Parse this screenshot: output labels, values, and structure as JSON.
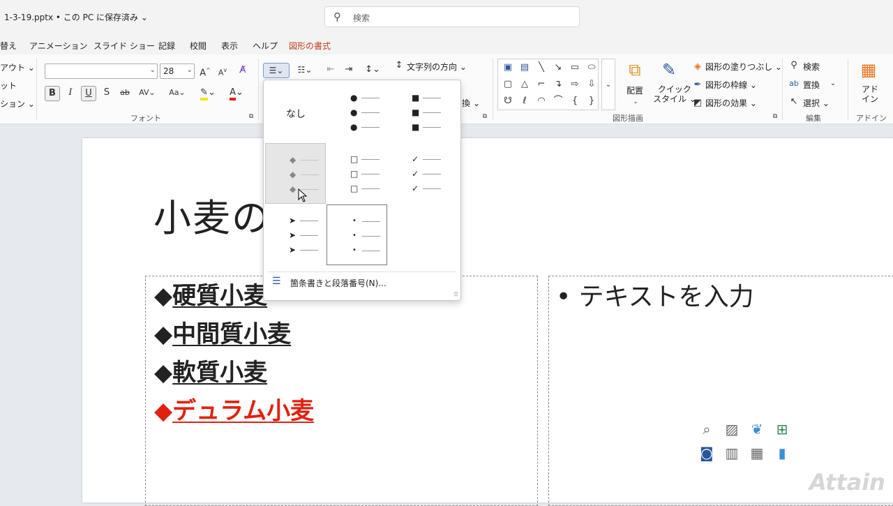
{
  "titlebar": {
    "filename": "1-3-19.pptx • この PC に保存済み ⌄",
    "search_placeholder": "検索"
  },
  "tabs": [
    "替え",
    "アニメーション",
    "スライド ショー",
    "記録",
    "校閲",
    "表示",
    "ヘルプ",
    "図形の書式"
  ],
  "ribbon": {
    "left_items": [
      "アウト ⌄",
      "ット",
      "ション ⌄"
    ],
    "font_name": "",
    "font_size": "28",
    "font_group_label": "フォント",
    "text_direction": "文字列の方向 ⌄",
    "convert_partial": "換 ⌄",
    "drawing_group_label": "図形描画",
    "arrange_label": "配置",
    "quick_style_label": "クイック\nスタイル ⌄",
    "shape_fill": "図形の塗りつぶし ⌄",
    "shape_outline": "図形の枠線 ⌄",
    "shape_effects": "図形の効果 ⌄",
    "find": "検索",
    "replace": "置換",
    "select": "選択 ⌄",
    "editing_group_label": "編集",
    "addins_label": "アド\nイン",
    "addins_group_label": "アドイン"
  },
  "dropdown": {
    "none_label": "なし",
    "footer": "箇条書きと段落番号(N)..."
  },
  "slide": {
    "title": "小麦の",
    "left_items": [
      {
        "bullet": "◆",
        "text": "硬質小麦"
      },
      {
        "bullet": "◆",
        "text": "中間質小麦"
      },
      {
        "bullet": "◆",
        "text": "軟質小麦"
      },
      {
        "bullet": "◆",
        "text": "デュラム小麦"
      }
    ],
    "right_placeholder": "• テキストを入力"
  },
  "watermark": "Attain",
  "colors": {
    "accent": "#c43e1c",
    "red_text": "#e3200f"
  }
}
